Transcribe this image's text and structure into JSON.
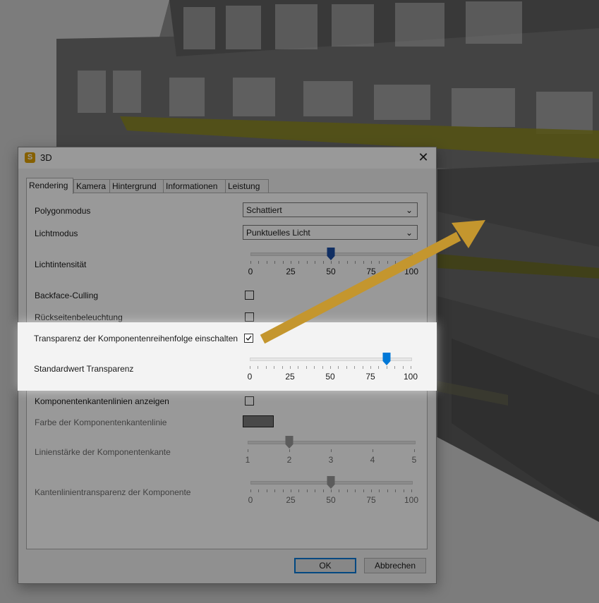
{
  "window": {
    "title": "3D",
    "app_icon_letter": "S"
  },
  "tabs": [
    {
      "label": "Rendering",
      "active": true
    },
    {
      "label": "Kamera",
      "active": false
    },
    {
      "label": "Hintergrund",
      "active": false
    },
    {
      "label": "Informationen",
      "active": false
    },
    {
      "label": "Leistung",
      "active": false
    }
  ],
  "settings": {
    "polygon_mode": {
      "label": "Polygonmodus",
      "value": "Schattiert"
    },
    "light_mode": {
      "label": "Lichtmodus",
      "value": "Punktuelles Licht"
    },
    "light_intensity": {
      "label": "Lichtintensität",
      "value": 50,
      "ticks": [
        "0",
        "25",
        "50",
        "75",
        "100"
      ]
    },
    "backface_culling": {
      "label": "Backface-Culling",
      "checked": false
    },
    "backside_lighting": {
      "label": "Rückseitenbeleuchtung",
      "checked": false
    },
    "component_order_transparency": {
      "label": "Transparenz der Komponentenreihenfolge einschalten",
      "checked": true
    },
    "default_transparency": {
      "label": "Standardwert Transparenz",
      "value": 85,
      "ticks": [
        "0",
        "25",
        "50",
        "75",
        "100"
      ]
    },
    "show_edge_lines": {
      "label": "Komponentenkantenlinien anzeigen",
      "checked": false
    },
    "edge_line_color": {
      "label": "Farbe der Komponentenkantenlinie",
      "color": "#7a7a7a"
    },
    "edge_line_width": {
      "label": "Linienstärke der Komponentenkante",
      "value": 2,
      "ticks": [
        "1",
        "2",
        "3",
        "4",
        "5"
      ]
    },
    "edge_line_transparency": {
      "label": "Kantenlinientransparenz der Komponente",
      "value": 50,
      "ticks": [
        "0",
        "25",
        "50",
        "75",
        "100"
      ]
    }
  },
  "buttons": {
    "ok": "OK",
    "cancel": "Abbrechen"
  },
  "colors": {
    "accent": "#0078d7",
    "intensity_thumb": "#1d4fa5",
    "disabled_thumb": "#9a9a9a",
    "arrow": "#c4962e"
  }
}
